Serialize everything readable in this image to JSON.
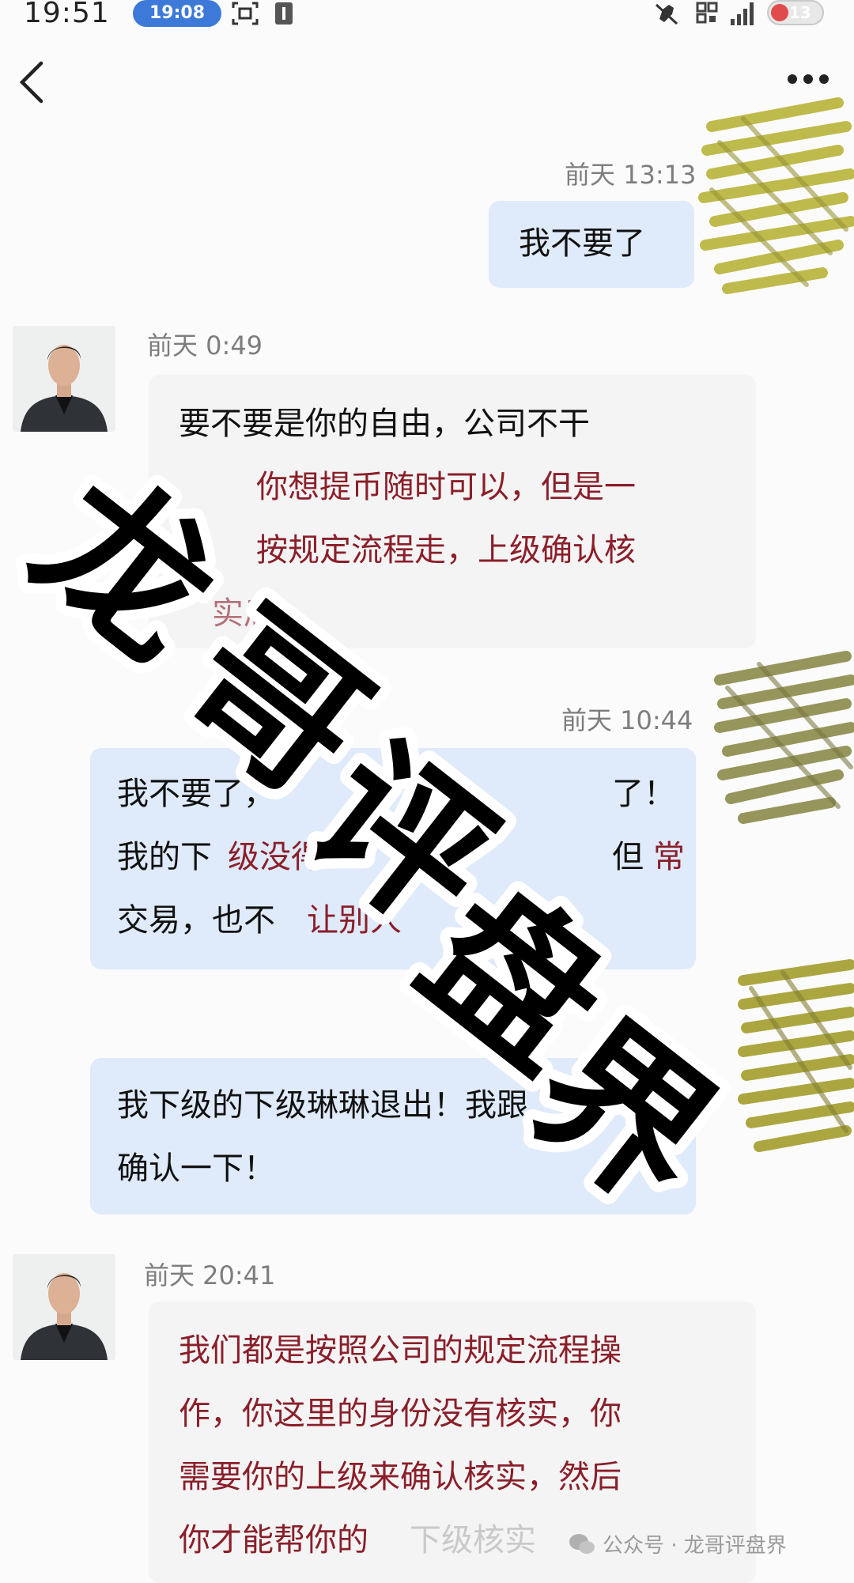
{
  "status_bar": {
    "time": "19:51",
    "pill": "19:08",
    "battery": "13"
  },
  "nav": {
    "back_icon": "chevron-left-icon",
    "more_icon": "more-dots-icon"
  },
  "messages": [
    {
      "side": "me",
      "time": "前天 13:13",
      "lines": [
        "我不要了"
      ]
    },
    {
      "side": "them",
      "time": "前天  0:49",
      "lines": [
        "要不要是你的自由，公司不干",
        "你想提币随时可以，但是一",
        "按规定流程走，上级确认核",
        "实后"
      ]
    },
    {
      "side": "me",
      "time": "前天 10:44",
      "lines": [
        "我不要了，",
        "了！但",
        "我的下",
        "级没得",
        "常",
        "交易，也不",
        "让别人"
      ]
    },
    {
      "side": "me",
      "time": "",
      "lines": [
        "我下级的下级琳琳退出！我跟",
        "确认一下！"
      ]
    },
    {
      "side": "them",
      "time": "前天 20:41",
      "lines": [
        "我们都是按照公司的规定流程操",
        "作，你这里的身份没有核实，你",
        "需要你的上级来确认核实，然后",
        "你才能帮你的",
        "下级核实"
      ]
    }
  ],
  "watermark": {
    "stamp_text": "龙哥评盘界",
    "footer": "公众号 · 龙哥评盘界"
  },
  "colors": {
    "bubble_me": "#dfeafa",
    "bubble_them": "#f4f4f4",
    "emphasis_red": "#8a1f2a",
    "scribble": "#b8b43a"
  }
}
